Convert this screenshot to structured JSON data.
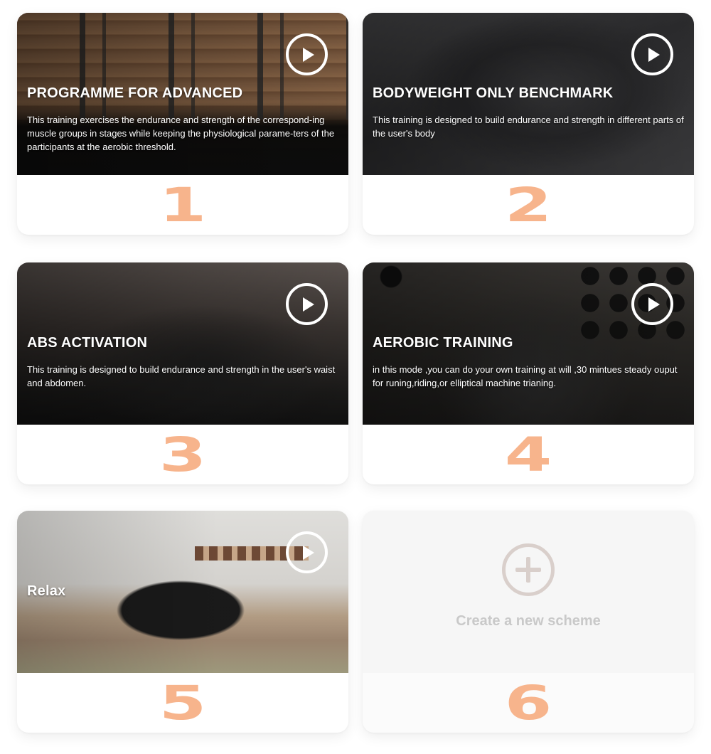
{
  "cards": [
    {
      "title": "PROGRAMME FOR ADVANCED",
      "description": "This training exercises the endurance and strength of the correspond-ing muscle groups in stages while keeping the physiological parame-ters of the participants at  the aerobic threshold.",
      "number": "1",
      "icon": "play-icon"
    },
    {
      "title": "BODYWEIGHT ONLY BENCHMARK",
      "description": "This training is designed to build endurance and strength in different parts of the user's body",
      "number": "2",
      "icon": "play-icon"
    },
    {
      "title": "ABS ACTIVATION",
      "description": "This training is designed to build endurance and strength in the user's waist and abdomen.",
      "number": "3",
      "icon": "play-icon"
    },
    {
      "title": "AEROBIC TRAINING",
      "description": "in this mode ,you can do your own training at will ,30 mintues steady ouput for runing,riding,or elliptical machine trianing.",
      "number": "4",
      "icon": "play-icon"
    },
    {
      "title": "Relax",
      "description": "",
      "number": "5",
      "icon": "play-icon"
    }
  ],
  "new_scheme": {
    "label": "Create a new scheme",
    "number": "6",
    "icon": "plus-circle-icon"
  },
  "colors": {
    "number": "#f7b48c",
    "create_label": "#c9c9c9",
    "plus_circle": "#d9cfcb"
  }
}
